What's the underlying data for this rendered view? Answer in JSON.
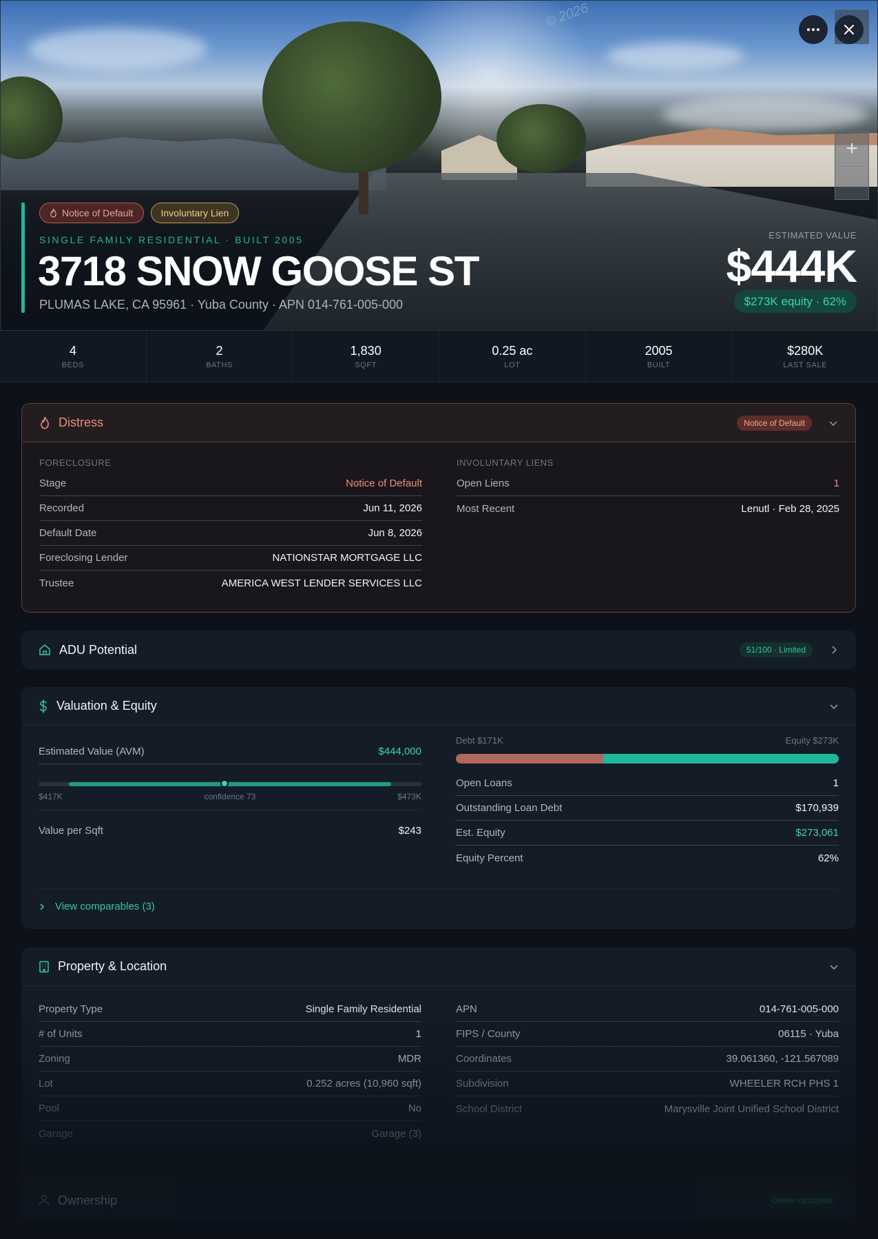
{
  "hero": {
    "badges": [
      "Notice of Default",
      "Involuntary Lien"
    ],
    "subtitle": "SINGLE FAMILY RESIDENTIAL · BUILT 2005",
    "title": "3718 SNOW GOOSE ST",
    "address": "PLUMAS LAKE, CA 95961 · Yuba County · APN 014-761-005-000",
    "estimated_label": "ESTIMATED VALUE",
    "estimated_value": "$444K",
    "equity_pill": "$273K equity · 62%",
    "watermark": "© 2026",
    "zoom_in": "+",
    "icons": [
      "more-icon",
      "close-icon",
      "plus-icon",
      "minus-icon"
    ]
  },
  "stats": [
    {
      "value": "4",
      "label": "BEDS"
    },
    {
      "value": "2",
      "label": "BATHS"
    },
    {
      "value": "1,830",
      "label": "SQFT"
    },
    {
      "value": "0.25 ac",
      "label": "LOT"
    },
    {
      "value": "2005",
      "label": "BUILT"
    },
    {
      "value": "$280K",
      "label": "LAST SALE"
    }
  ],
  "distress": {
    "title": "Distress",
    "badge": "Notice of Default",
    "foreclosure_label": "FORECLOSURE",
    "foreclosure": [
      {
        "k": "Stage",
        "v": "Notice of Default"
      },
      {
        "k": "Recorded",
        "v": "Jun 11, 2026"
      },
      {
        "k": "Default Date",
        "v": "Jun 8, 2026"
      },
      {
        "k": "Foreclosing Lender",
        "v": "NATIONSTAR MORTGAGE LLC"
      },
      {
        "k": "Trustee",
        "v": "AMERICA WEST LENDER SERVICES LLC"
      }
    ],
    "liens_label": "INVOLUNTARY LIENS",
    "liens": [
      {
        "k": "Open Liens",
        "v": "1"
      },
      {
        "k": "Most Recent",
        "v": "Lenutl · Feb 28, 2025"
      }
    ]
  },
  "adu": {
    "title": "ADU Potential",
    "score": "51/100 · Limited"
  },
  "valuation": {
    "title": "Valuation & Equity",
    "avm_label": "Estimated Value (AVM)",
    "avm_value": "$444,000",
    "range_low": "$417K",
    "confidence": "confidence 73",
    "range_high": "$473K",
    "avm_range": {
      "low": 417000,
      "high": 473000,
      "value": 444000
    },
    "value_per_sqft_label": "Value per Sqft",
    "value_per_sqft": "$243",
    "debt_label": "Debt $171K",
    "equity_label": "Equity $273K",
    "debt_share": 0.385,
    "loans": [
      {
        "k": "Open Loans",
        "v": "1"
      },
      {
        "k": "Outstanding Loan Debt",
        "v": "$170,939"
      },
      {
        "k": "Est. Equity",
        "v": "$273,061"
      },
      {
        "k": "Equity Percent",
        "v": "62%"
      }
    ],
    "comparables": "View comparables (3)"
  },
  "property": {
    "title": "Property & Location",
    "left": [
      {
        "k": "Property Type",
        "v": "Single Family Residential"
      },
      {
        "k": "# of Units",
        "v": "1"
      },
      {
        "k": "Zoning",
        "v": "MDR"
      },
      {
        "k": "Lot",
        "v": "0.252 acres (10,960 sqft)"
      },
      {
        "k": "Pool",
        "v": "No"
      },
      {
        "k": "Garage",
        "v": "Garage (3)"
      }
    ],
    "right": [
      {
        "k": "APN",
        "v": "014-761-005-000"
      },
      {
        "k": "FIPS / County",
        "v": "06115 · Yuba"
      },
      {
        "k": "Coordinates",
        "v": "39.061360, -121.567089"
      },
      {
        "k": "Subdivision",
        "v": "WHEELER RCH PHS 1"
      },
      {
        "k": "School District",
        "v": "Marysville Joint Unified School District"
      }
    ]
  },
  "ownership": {
    "title": "Ownership",
    "badge": "Owner-occupied"
  },
  "colors": {
    "accent": "#21b79a",
    "distress": "#ee8c7c",
    "lien": "#e8cf8c",
    "background": "#0d121a"
  }
}
